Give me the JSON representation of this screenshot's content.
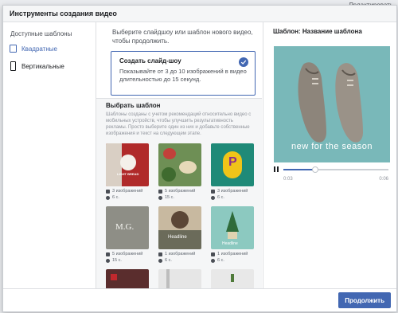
{
  "backdrop": {
    "link_text": "Редактировать"
  },
  "dialog": {
    "title": "Инструменты создания видео",
    "nav": {
      "heading": "Доступные шаблоны",
      "items": [
        {
          "label": "Квадратные",
          "active": true
        },
        {
          "label": "Вертикальные",
          "active": false
        }
      ]
    },
    "center": {
      "intro": "Выберите слайдшоу или шаблон нового видео, чтобы продолжить.",
      "create_card": {
        "title": "Создать слайд-шоу",
        "description": "Показывайте от 3 до 10 изображений в видео длительностью до 15 секунд."
      },
      "templates": {
        "heading": "Выбрать шаблон",
        "description": "Шаблоны созданы с учетом рекомендаций относительно видео с мобильных устройств, чтобы улучшить результативность рекламы. Просто выберите один из них и добавьте собственные изображения и текст на следующем этапе.",
        "items": [
          {
            "images": "3 изображений",
            "duration": "6 с.",
            "thumb_text": "LIGHT BREAD",
            "bg": "#b02a2a"
          },
          {
            "images": "5 изображений",
            "duration": "15 с.",
            "thumb_text": "",
            "bg": "#6e8f55"
          },
          {
            "images": "3 изображений",
            "duration": "6 с.",
            "thumb_text": "P",
            "bg": "#1f8a78"
          },
          {
            "images": "5 изображений",
            "duration": "15 с.",
            "thumb_text": "M.G.",
            "bg": "#8e8e86"
          },
          {
            "images": "1 изображений",
            "duration": "6 с.",
            "thumb_text": "Headline",
            "bg": "#c8b9a0"
          },
          {
            "images": "1 изображений",
            "duration": "6 с.",
            "thumb_text": "Headline",
            "bg": "#8cc9c0"
          },
          {
            "images": "",
            "duration": "",
            "thumb_text": "",
            "bg": "#5a2d2d"
          },
          {
            "images": "",
            "duration": "",
            "thumb_text": "",
            "bg": "#e6e6e6"
          },
          {
            "images": "",
            "duration": "",
            "thumb_text": "",
            "bg": "#e8e8e8"
          }
        ]
      }
    },
    "preview": {
      "title": "Шаблон: Название шаблона",
      "overlay_text": "new for the season",
      "time_start": "0:03",
      "time_end": "0:06",
      "progress": 0.3
    },
    "footer": {
      "continue_label": "Продолжить"
    }
  },
  "colors": {
    "accent": "#4267b2",
    "preview_bg": "#79b8b9"
  }
}
